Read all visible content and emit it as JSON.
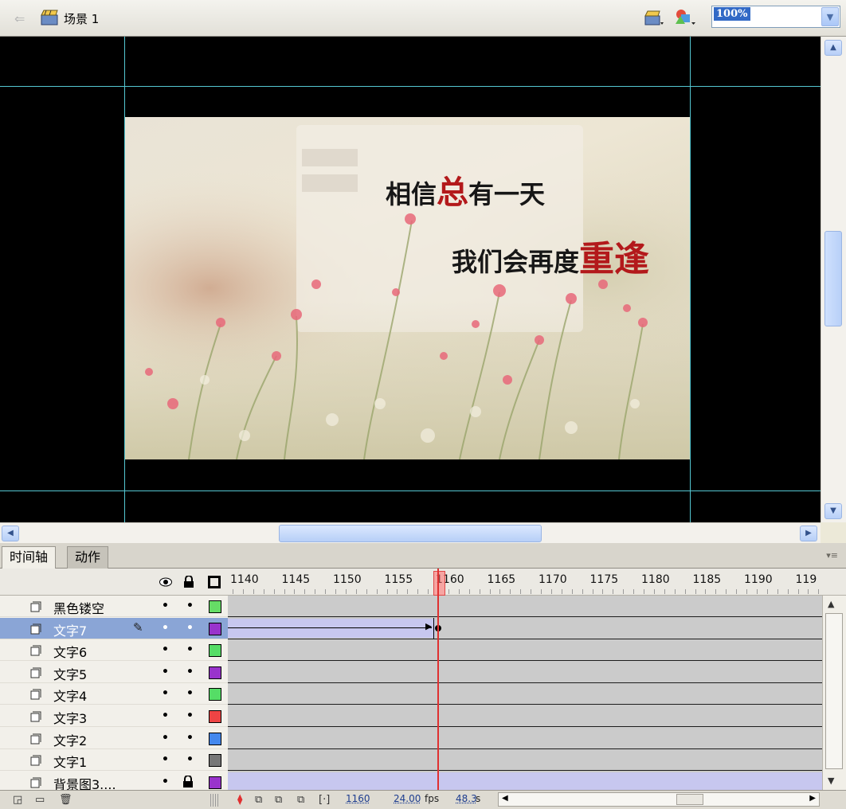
{
  "topbar": {
    "scene_label": "场景 1",
    "zoom_value": "100%"
  },
  "stage": {
    "text_line1_prefix": "相信",
    "text_line1_highlight": "总",
    "text_line1_suffix": "有一天",
    "text_line2_prefix": "我们会再度",
    "text_line2_highlight": "重逢",
    "highlight_color": "#b3191b"
  },
  "panel": {
    "tab_timeline": "时间轴",
    "tab_actions": "动作"
  },
  "ruler": {
    "labels": [
      "1140",
      "1145",
      "1150",
      "1155",
      "1160",
      "1165",
      "1170",
      "1175",
      "1180",
      "1185",
      "1190",
      "119"
    ]
  },
  "layers": [
    {
      "name": "黑色镂空",
      "color": "#66dd66"
    },
    {
      "name": "文字7",
      "color": "#9933cc"
    },
    {
      "name": "文字6",
      "color": "#55dd66"
    },
    {
      "name": "文字5",
      "color": "#9933cc"
    },
    {
      "name": "文字4",
      "color": "#55dd66"
    },
    {
      "name": "文字3",
      "color": "#ee4444"
    },
    {
      "name": "文字2",
      "color": "#4488ee"
    },
    {
      "name": "文字1",
      "color": "#777777"
    },
    {
      "name": "背景图3....",
      "color": "#9933cc"
    }
  ],
  "status": {
    "current_frame": "1160",
    "fps_value": "24.00",
    "fps_unit": "fps",
    "time_value": "48.3",
    "time_unit": "s"
  }
}
